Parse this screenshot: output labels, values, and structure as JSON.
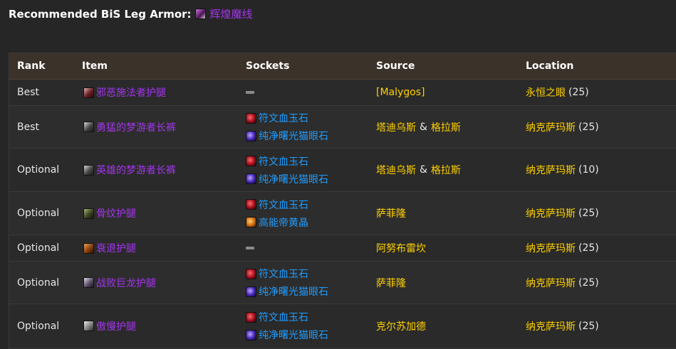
{
  "heading": {
    "label": "Recommended BiS Leg Armor:",
    "enchant_name": "辉煌魔线",
    "enchant_icon": "enchant-spellthread-icon"
  },
  "table": {
    "columns": {
      "rank": "Rank",
      "item": "Item",
      "sockets": "Sockets",
      "source": "Source",
      "location": "Location"
    },
    "rows": [
      {
        "rank": "Best",
        "item": "邪恶施法者护腿",
        "icon": "leggings-icon",
        "sockets": [],
        "source": "[Malygos]",
        "source2": "",
        "location": "永恒之眼",
        "level": "(25)"
      },
      {
        "rank": "Best",
        "item": "勇猛的梦游者长裤",
        "icon": "pants-icon",
        "sockets": [
          "符文血玉石",
          "纯净曙光猫眼石"
        ],
        "source": "塔迪乌斯",
        "source2": "格拉斯",
        "location": "纳克萨玛斯",
        "level": "(25)"
      },
      {
        "rank": "Optional",
        "item": "英雄的梦游者长裤",
        "icon": "pants-icon",
        "sockets": [
          "符文血玉石",
          "纯净曙光猫眼石"
        ],
        "source": "塔迪乌斯",
        "source2": "格拉斯",
        "location": "纳克萨玛斯",
        "level": "(10)"
      },
      {
        "rank": "Optional",
        "item": "骨纹护腿",
        "icon": "bone-leggings-icon",
        "sockets": [
          "符文血玉石",
          "高能帝黄晶"
        ],
        "source": "萨菲隆",
        "source2": "",
        "location": "纳克萨玛斯",
        "level": "(25)"
      },
      {
        "rank": "Optional",
        "item": "衰退护腿",
        "icon": "decay-leggings-icon",
        "sockets": [],
        "source": "阿努布雷坎",
        "source2": "",
        "location": "纳克萨玛斯",
        "level": "(25)"
      },
      {
        "rank": "Optional",
        "item": "战败巨龙护腿",
        "icon": "dragon-leggings-icon",
        "sockets": [
          "符文血玉石",
          "纯净曙光猫眼石"
        ],
        "source": "萨菲隆",
        "source2": "",
        "location": "纳克萨玛斯",
        "level": "(25)"
      },
      {
        "rank": "Optional",
        "item": "傲慢护腿",
        "icon": "arrogance-leggings-icon",
        "sockets": [
          "符文血玉石",
          "纯净曙光猫眼石"
        ],
        "source": "克尔苏加德",
        "source2": "",
        "location": "纳克萨玛斯",
        "level": "(25)"
      }
    ]
  }
}
